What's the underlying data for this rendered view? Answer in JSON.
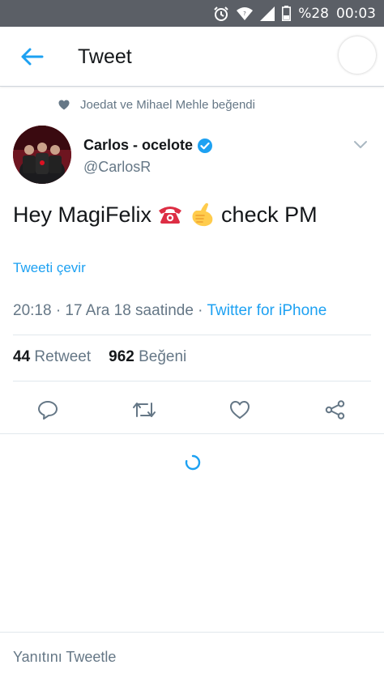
{
  "status_bar": {
    "battery": "%28",
    "time": "00:03",
    "icons": [
      "alarm-icon",
      "wifi-icon",
      "signal-icon",
      "battery-icon"
    ]
  },
  "header": {
    "title": "Tweet",
    "back_icon": "arrow-left-icon"
  },
  "social_context": {
    "text": "Joedat ve Mihael Mehle beğendi",
    "icon": "heart-icon"
  },
  "author": {
    "name": "Carlos - ocelote",
    "handle": "@CarlosR",
    "verified": true
  },
  "tweet": {
    "text_before": "Hey MagiFelix",
    "emojis": [
      "telephone-emoji",
      "call-me-hand-emoji"
    ],
    "text_after": "check PM",
    "translate_label": "Tweeti çevir",
    "timestamp": "20:18 · 17 Ara 18 saatinde · ",
    "source": "Twitter for iPhone"
  },
  "stats": {
    "retweets_count": "44",
    "retweets_label": "Retweet",
    "likes_count": "962",
    "likes_label": "Beğeni"
  },
  "actions": [
    "reply-icon",
    "retweet-icon",
    "like-icon",
    "share-icon"
  ],
  "reply": {
    "placeholder": "Yanıtını Tweetle"
  },
  "colors": {
    "accent": "#1da1f2",
    "secondary_text": "#657786",
    "status_bar": "#5b5f66"
  }
}
